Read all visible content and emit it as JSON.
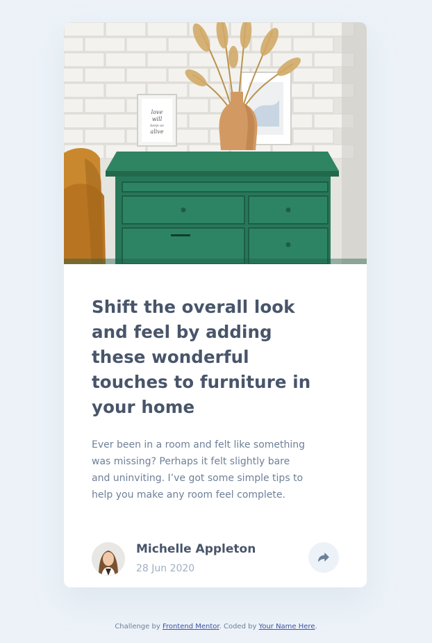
{
  "article": {
    "title": "Shift the overall look and feel by adding these wonderful touches to furniture in your home",
    "description": "Ever been in a room and felt like something was missing? Perhaps it felt slightly bare and uninviting. I’ve got some simple tips to help you make any room feel complete.",
    "image_icon": "drawers-photo",
    "frame_text": [
      "love",
      "will",
      "keep us",
      "alive"
    ]
  },
  "author": {
    "name": "Michelle Appleton",
    "date": "28 Jun 2020",
    "avatar_icon": "avatar-photo"
  },
  "share": {
    "icon": "share-arrow-icon"
  },
  "attribution": {
    "prefix": "Challenge by ",
    "link1_text": "Frontend Mentor",
    "middle": ". Coded by ",
    "link2_text": "Your Name Here",
    "suffix": "."
  },
  "colors": {
    "page_bg": "#ecf2f8",
    "card_bg": "#ffffff",
    "title": "#48556a",
    "body_text": "#6e8098",
    "muted": "#9eafc2",
    "link": "#3e52a3"
  }
}
